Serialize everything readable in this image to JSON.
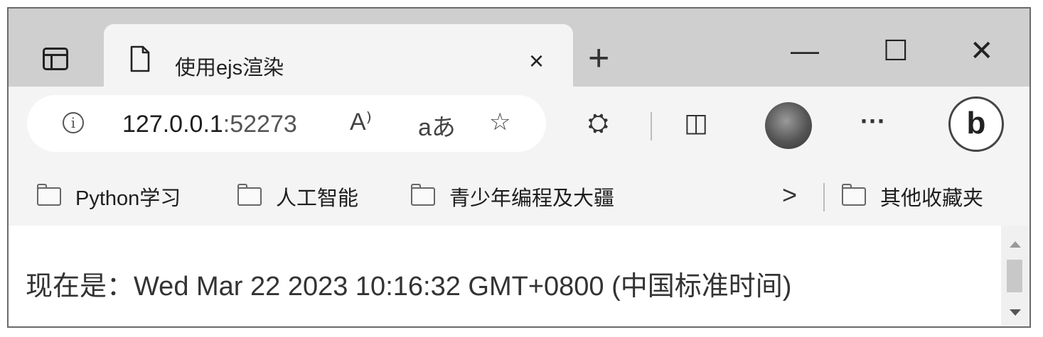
{
  "tab": {
    "title": "使用ejs渲染",
    "close_glyph": "×"
  },
  "newtab_glyph": "+",
  "window_controls": {
    "minimize": "—",
    "maximize": "☐",
    "close": "✕"
  },
  "address": {
    "host": "127.0.0.1",
    "port": ":52273",
    "info_glyph": "i"
  },
  "omnibox_icons": {
    "read_aloud": "A⁾",
    "translate": "aあ",
    "favorite": "☆"
  },
  "toolbar_icons": {
    "extensions": "⛭",
    "split_screen": "◫",
    "more": "···",
    "bing": "b"
  },
  "bookmarks": [
    {
      "label": "Python学习"
    },
    {
      "label": "人工智能"
    },
    {
      "label": "青少年编程及大疆"
    }
  ],
  "other_favorites": "其他收藏夹",
  "overflow_glyph": ">",
  "content": {
    "text": "现在是：Wed Mar 22 2023 10:16:32 GMT+0800 (中国标准时间)"
  }
}
